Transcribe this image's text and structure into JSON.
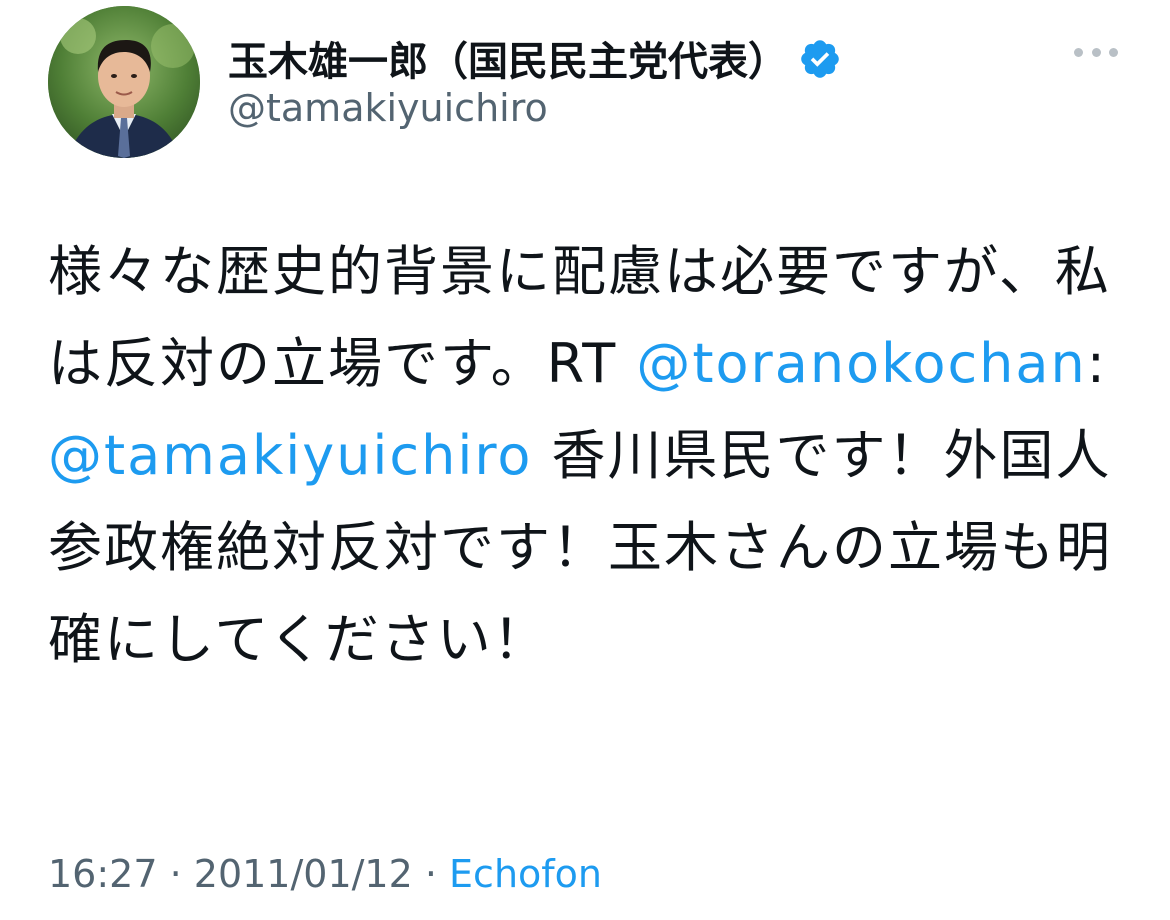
{
  "author": {
    "display_name": "玉木雄一郎（国民民主党代表）",
    "handle": "@tamakiyuichiro",
    "verified_icon": "verified-badge-icon",
    "avatar_icon": "avatar"
  },
  "menu": {
    "icon": "more-options-icon"
  },
  "tweet": {
    "text_part1": "様々な歴史的背景に配慮は必要ですが、私は反対の立場です。RT ",
    "mention1": "@toranokochan",
    "text_part2": ": ",
    "mention2": "@tamakiyuichiro",
    "text_part3": " 香川県民です！外国人参政権絶対反対です！玉木さんの立場も明確にしてください！"
  },
  "meta": {
    "time": "16:27",
    "separator1": " · ",
    "date": "2011/01/12",
    "separator2": " · ",
    "source": "Echofon"
  },
  "colors": {
    "accent": "#1d9bf0",
    "text": "#0f1419",
    "secondary": "#536471"
  }
}
